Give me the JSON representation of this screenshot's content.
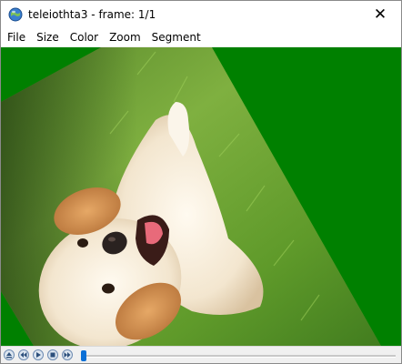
{
  "window": {
    "title": "teleiothta3 - frame: 1/1",
    "close_glyph": "✕"
  },
  "menu": {
    "items": [
      "File",
      "Size",
      "Color",
      "Zoom",
      "Segment"
    ]
  },
  "viewport": {
    "background_color": "#008000",
    "image_description_icon": "rotated-photo"
  },
  "controls": {
    "buttons": [
      {
        "name": "eject-button",
        "icon": "eject-icon"
      },
      {
        "name": "rewind-button",
        "icon": "rewind-icon"
      },
      {
        "name": "play-button",
        "icon": "play-icon"
      },
      {
        "name": "stop-button",
        "icon": "stop-icon"
      },
      {
        "name": "fast-forward-button",
        "icon": "fast-forward-icon"
      }
    ],
    "frame_position": 0
  },
  "colors": {
    "accent": "#0a6fd6",
    "background_green": "#008000"
  }
}
